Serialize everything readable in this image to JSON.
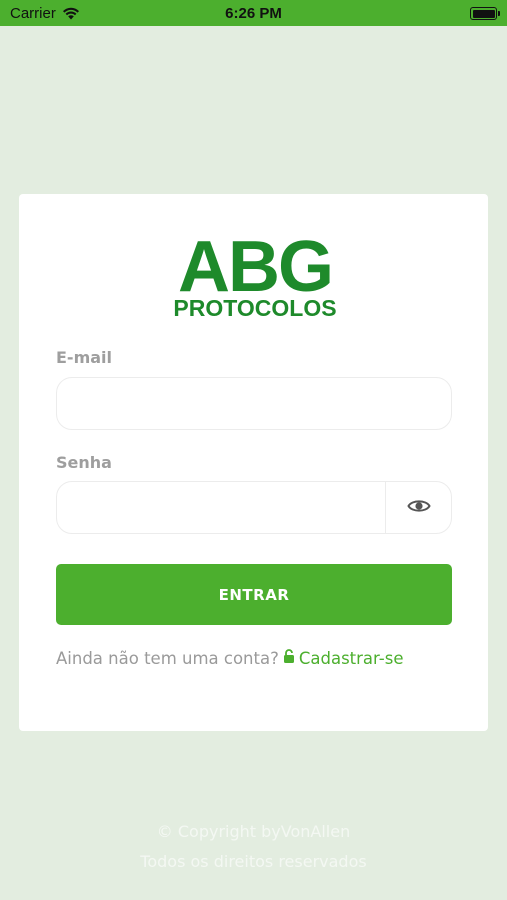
{
  "status_bar": {
    "carrier": "Carrier",
    "time": "6:26 PM"
  },
  "logo": {
    "main": "ABG",
    "sub": "PROTOCOLOS"
  },
  "form": {
    "email_label": "E-mail",
    "email_value": "",
    "password_label": "Senha",
    "password_value": "",
    "submit_label": "ENTRAR",
    "no_account_text": "Ainda não tem uma conta?",
    "signup_label": "Cadastrar-se"
  },
  "footer": {
    "copyright": "© Copyright byVonAllen",
    "rights": "Todos os direitos reservados"
  },
  "colors": {
    "accent": "#4caf2e",
    "logo": "#1e8a2b",
    "background": "#e3ede0"
  }
}
